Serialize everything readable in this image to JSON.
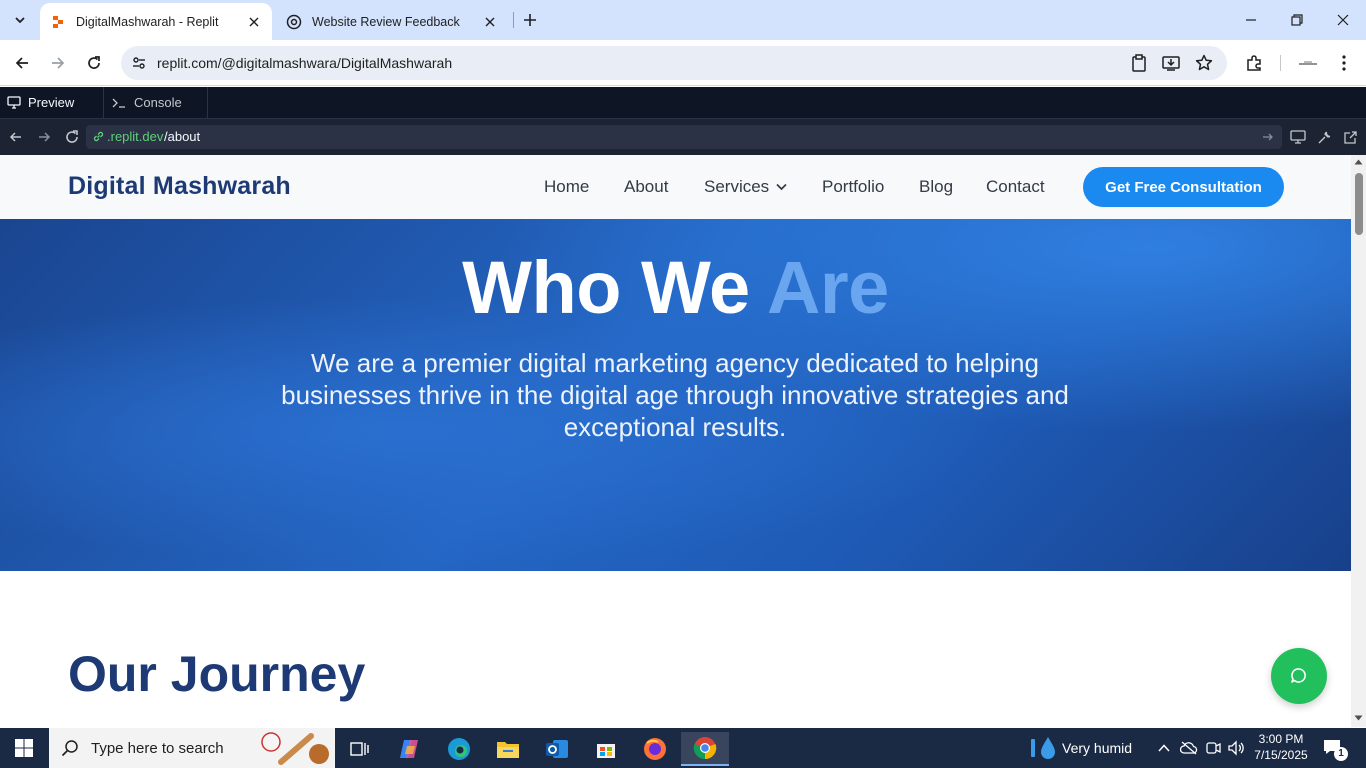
{
  "browser": {
    "tabs": [
      {
        "title": "DigitalMashwarah - Replit",
        "active": true
      },
      {
        "title": "Website Review Feedback",
        "active": false
      }
    ],
    "address": "replit.com/@digitalmashwara/DigitalMashwarah"
  },
  "replit": {
    "tabs": [
      {
        "label": "Preview",
        "active": true
      },
      {
        "label": "Console",
        "active": false
      }
    ],
    "url_domain": ".replit.dev",
    "url_path": "/about"
  },
  "site": {
    "logo": "Digital Mashwarah",
    "nav": [
      "Home",
      "About",
      "Services",
      "Portfolio",
      "Blog",
      "Contact"
    ],
    "cta": "Get Free Consultation",
    "hero_title_main": "Who We ",
    "hero_title_accent": "Are",
    "hero_subtitle": "We are a premier digital marketing agency dedicated to helping businesses thrive in the digital age through innovative strategies and exceptional results.",
    "section_heading": "Our Journey",
    "colors": {
      "brand_dark": "#1e3a75",
      "cta_blue": "#1b8af0",
      "hero_blue": "#2466c4",
      "accent_light_blue": "#6aa5f0",
      "chat_green": "#22c05d"
    }
  },
  "taskbar": {
    "search_placeholder": "Type here to search",
    "weather": "Very humid",
    "time": "3:00 PM",
    "date": "7/15/2025",
    "notification_count": "1"
  }
}
